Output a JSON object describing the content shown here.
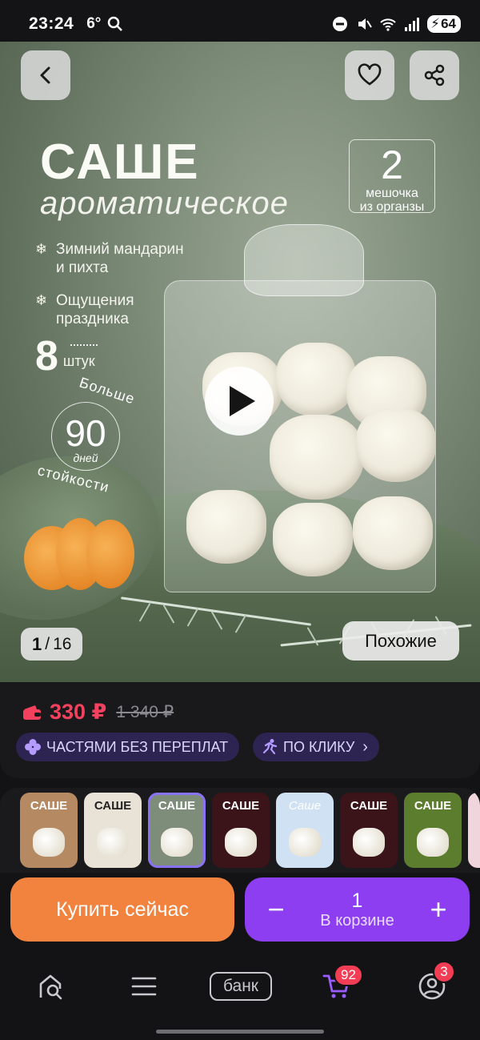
{
  "status_bar": {
    "time": "23:24",
    "temp": "6°",
    "battery": "64"
  },
  "hero": {
    "title": "САШЕ",
    "subtitle": "ароматическое",
    "feature_1_line1": "Зимний мандарин",
    "feature_1_line2": "и пихта",
    "feature_2_line1": "Ощущения",
    "feature_2_line2": "праздника",
    "qty_number": "8",
    "qty_unit": "штук",
    "badge_top": "Больше",
    "badge_number": "90",
    "badge_days": "дней",
    "badge_bottom": "стойкости",
    "bag_count": "2",
    "bag_line1": "мешочка",
    "bag_line2": "из органзы",
    "counter_current": "1",
    "counter_sep": "/",
    "counter_total": "16",
    "similar_label": "Похожие"
  },
  "price": {
    "current": "330 ₽",
    "old": "1 340 ₽",
    "chip_installments": "ЧАСТЯМИ БЕЗ ПЕРЕПЛАТ",
    "chip_oneclick": "ПО КЛИКУ"
  },
  "thumbnails": [
    {
      "title": "САШЕ",
      "bg": "#b58a62"
    },
    {
      "title": "САШЕ",
      "bg": "#e9e2d6"
    },
    {
      "title": "САШЕ",
      "bg": "#7d8d79"
    },
    {
      "title": "САШЕ",
      "bg": "#3a1418"
    },
    {
      "title": "Саше",
      "bg": "#cfe1f3"
    },
    {
      "title": "САШЕ",
      "bg": "#3a1418"
    },
    {
      "title": "САШЕ",
      "bg": "#5d7d2e"
    },
    {
      "title": "",
      "bg": "#f0d6dc"
    }
  ],
  "actions": {
    "buy_now": "Купить сейчас",
    "minus": "−",
    "plus": "+",
    "cart_count": "1",
    "cart_label": "В корзине"
  },
  "nav": {
    "bank_label": "банк",
    "cart_badge": "92",
    "profile_badge": "3"
  },
  "colors": {
    "accent_purple": "#8c3ef0",
    "buy_orange": "#f2833f",
    "price_red": "#f4425e"
  }
}
